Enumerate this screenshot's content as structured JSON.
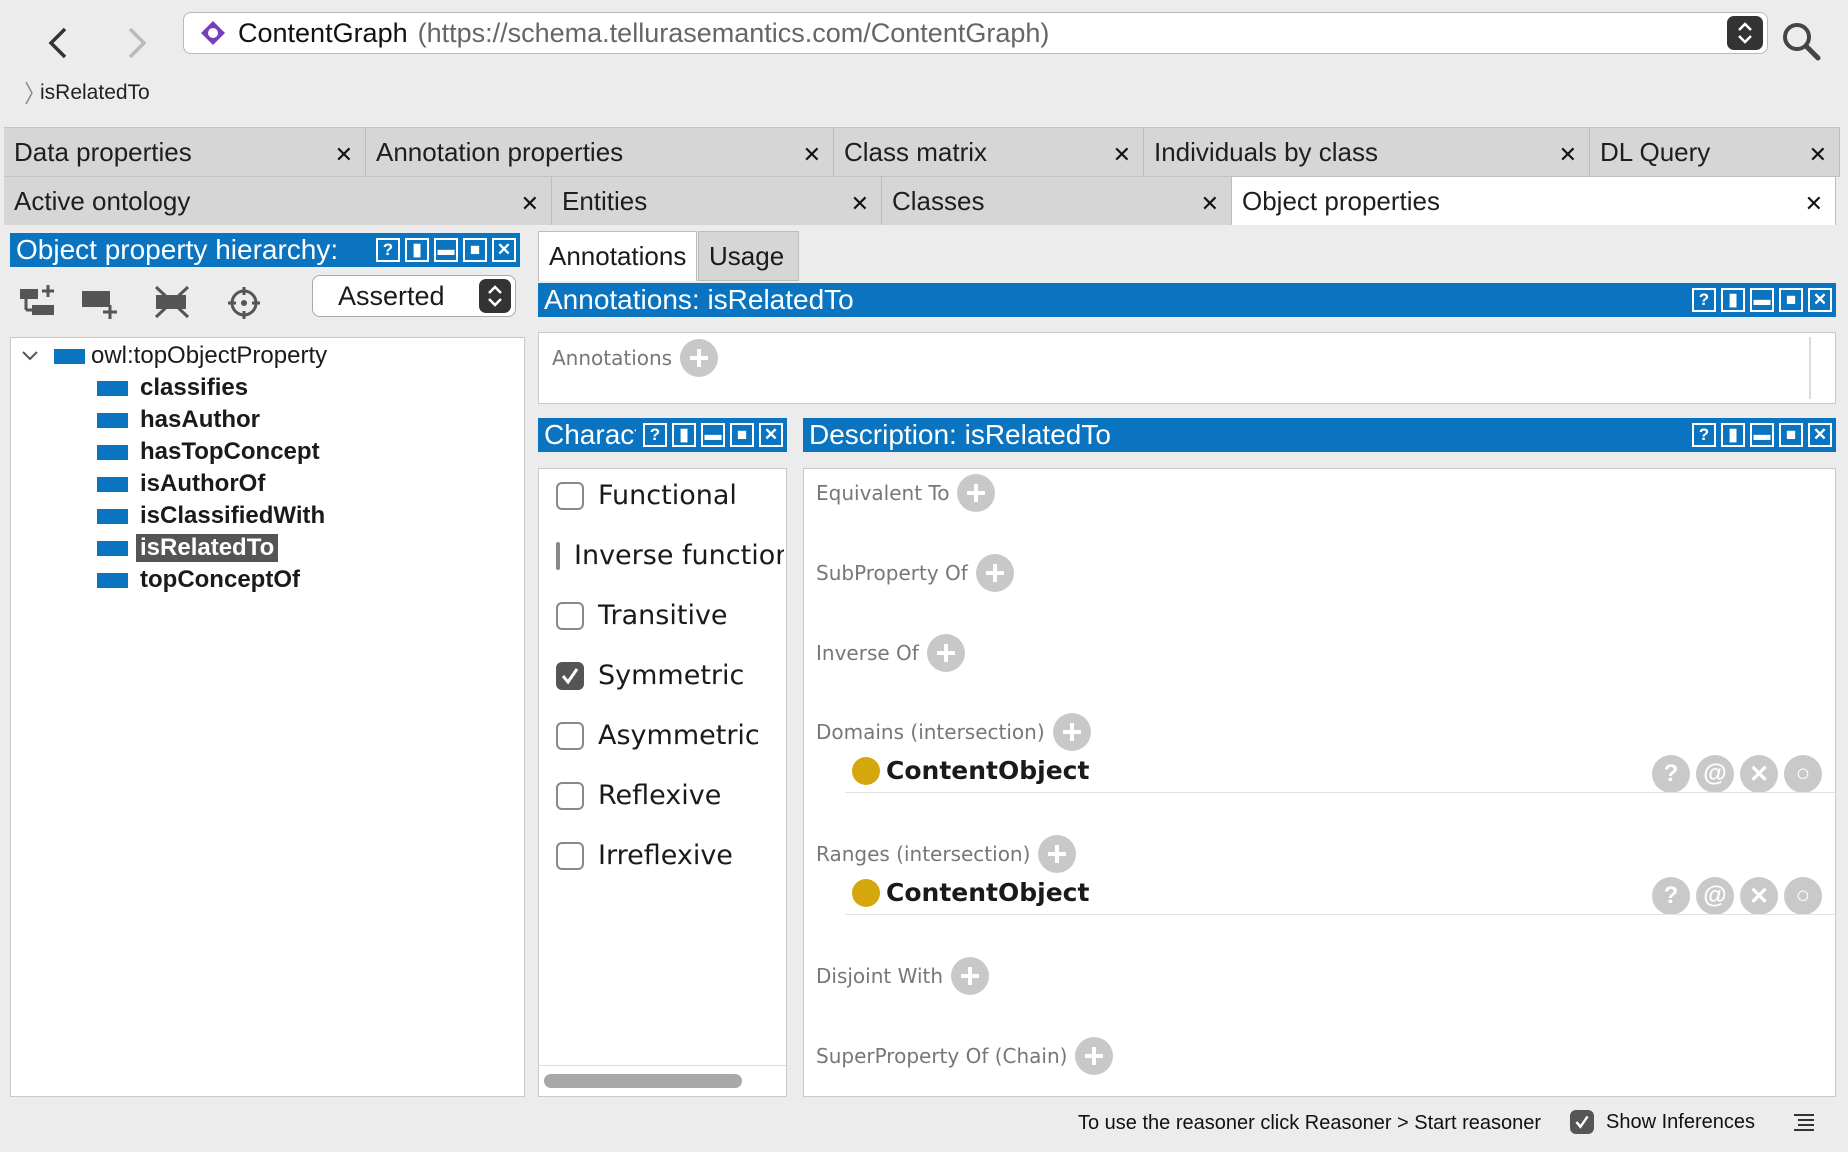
{
  "toolbar": {
    "ontology_name": "ContentGraph",
    "ontology_url": "(https://schema.tellurasemantics.com/ContentGraph)"
  },
  "breadcrumb": {
    "item": "isRelatedTo"
  },
  "tabs_row1": [
    {
      "label": "Data properties"
    },
    {
      "label": "Annotation properties"
    },
    {
      "label": "Class matrix"
    },
    {
      "label": "Individuals by class"
    },
    {
      "label": "DL Query"
    }
  ],
  "tabs_row2": [
    {
      "label": "Active ontology"
    },
    {
      "label": "Entities"
    },
    {
      "label": "Classes"
    },
    {
      "label": "Object properties"
    }
  ],
  "hierarchy": {
    "title": "Object property hierarchy:",
    "mode": "Asserted",
    "root": "owl:topObjectProperty",
    "items": [
      "classifies",
      "hasAuthor",
      "hasTopConcept",
      "isAuthorOf",
      "isClassifiedWith",
      "isRelatedTo",
      "topConceptOf"
    ],
    "selected": "isRelatedTo"
  },
  "inner_tabs": [
    "Annotations",
    "Usage"
  ],
  "annotations": {
    "title": "Annotations: isRelatedTo",
    "label": "Annotations"
  },
  "characteristics": {
    "title": "Characteristics",
    "items": [
      {
        "label": "Functional",
        "checked": false
      },
      {
        "label": "Inverse functional",
        "checked": false
      },
      {
        "label": "Transitive",
        "checked": false
      },
      {
        "label": "Symmetric",
        "checked": true
      },
      {
        "label": "Asymmetric",
        "checked": false
      },
      {
        "label": "Reflexive",
        "checked": false
      },
      {
        "label": "Irreflexive",
        "checked": false
      }
    ]
  },
  "description": {
    "title": "Description: isRelatedTo",
    "sections": {
      "equivalent": "Equivalent To",
      "subproperty": "SubProperty Of",
      "inverse": "Inverse Of",
      "domains": "Domains (intersection)",
      "ranges": "Ranges (intersection)",
      "disjoint": "Disjoint With",
      "chain": "SuperProperty Of (Chain)"
    },
    "domain_entry": "ContentObject",
    "range_entry": "ContentObject"
  },
  "status": {
    "message": "To use the reasoner click Reasoner > Start reasoner",
    "show_inferences": "Show Inferences"
  },
  "colors": {
    "accent": "#0a74c0",
    "class_dot": "#d4a80c"
  }
}
